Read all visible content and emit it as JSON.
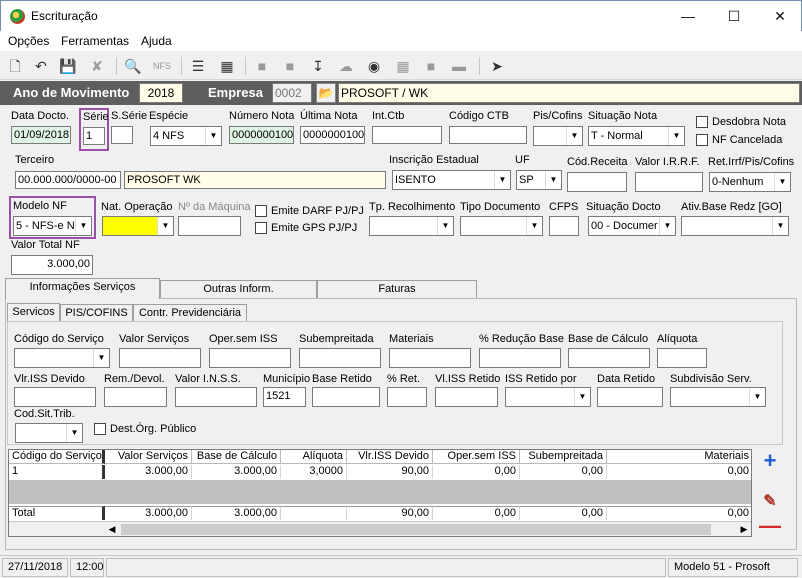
{
  "window": {
    "title": "Escrituração"
  },
  "menu": [
    "Opções",
    "Ferramentas",
    "Ajuda"
  ],
  "header": {
    "ano_label": "Ano de Movimento",
    "ano_value": "2018",
    "empresa_label": "Empresa",
    "empresa_code": "0002",
    "empresa_name": "PROSOFT / WK"
  },
  "row1": {
    "data_docto_label": "Data Docto.",
    "data_docto": "01/09/2018",
    "serie_label": "Série",
    "serie": "1",
    "sserie_label": "S.Série",
    "sserie": "",
    "especie_label": "Espécie",
    "especie": "4 NFS",
    "numero_nota_label": "Número Nota",
    "numero_nota": "0000000100",
    "ultima_nota_label": "Última Nota",
    "ultima_nota": "0000000100",
    "int_ctb_label": "Int.Ctb",
    "int_ctb": "",
    "codigo_ctb_label": "Código CTB",
    "codigo_ctb": "",
    "pis_cofins_label": "Pis/Cofins",
    "pis_cofins": "",
    "situacao_nota_label": "Situação Nota",
    "situacao_nota": "T - Normal",
    "desdobra_label": "Desdobra Nota",
    "nf_cancelada_label": "NF Cancelada"
  },
  "row2": {
    "terceiro_label": "Terceiro",
    "terceiro_code": "00.000.000/0000-00",
    "terceiro_name": "PROSOFT WK",
    "insc_est_label": "Inscrição Estadual",
    "insc_est": "ISENTO",
    "uf_label": "UF",
    "uf": "SP",
    "cod_receita_label": "Cód.Receita",
    "cod_receita": "",
    "valor_irrf_label": "Valor I.R.R.F.",
    "valor_irrf": "",
    "ret_irrf_label": "Ret.Irrf/Pis/Cofins",
    "ret_irrf": "0-Nenhum"
  },
  "row3": {
    "modelo_nf_label": "Modelo NF",
    "modelo_nf": "5 - NFS-e NF",
    "nat_operacao_label": "Nat. Operação",
    "nat_operacao": "",
    "num_maquina_label": "Nº da Máquina",
    "num_maquina": "",
    "emite_darf_label": "Emite DARF PJ/PJ",
    "emite_gps_label": "Emite GPS PJ/PJ",
    "tp_recolhimento_label": "Tp. Recolhimento",
    "tp_recolhimento": "",
    "tipo_documento_label": "Tipo Documento",
    "tipo_documento": "",
    "cfps_label": "CFPS",
    "cfps": "",
    "situacao_docto_label": "Situação Docto",
    "situacao_docto": "00 - Documer",
    "ativ_base_label": "Ativ.Base Redz [GO]",
    "ativ_base": ""
  },
  "valor_total": {
    "label": "Valor Total NF",
    "value": "3.000,00"
  },
  "main_tabs": [
    "Informações Serviços",
    "Outras Inform.",
    "Faturas"
  ],
  "sub_tabs": [
    "Servicos",
    "PIS/COFINS",
    "Contr. Previdenciária"
  ],
  "servicos": {
    "codigo_servico_label": "Código do Serviço",
    "valor_servicos_label": "Valor Serviços",
    "oper_sem_iss_label": "Oper.sem ISS",
    "subempreitada_label": "Subempreitada",
    "materiais_label": "Materiais",
    "reducao_base_label": "% Redução Base",
    "base_calculo_label": "Base de Cálculo",
    "aliquota_label": "Alíquota",
    "vlr_iss_devido_label": "Vlr.ISS Devido",
    "rem_devol_label": "Rem./Devol.",
    "valor_inss_label": "Valor I.N.S.S.",
    "municipio_label": "Município",
    "municipio": "1521",
    "base_retido_label": "Base Retido",
    "pct_ret_label": "% Ret.",
    "vl_iss_retido_label": "Vl.ISS Retido",
    "iss_retido_por_label": "ISS Retido por",
    "data_retido_label": "Data Retido",
    "subdivisao_label": "Subdivisão Serv.",
    "cod_sit_trib_label": "Cod.Sit.Trib.",
    "dest_org_publico_label": "Dest.Órg. Público"
  },
  "grid": {
    "columns": [
      "Código do Serviço",
      "Valor Serviços",
      "Base de Cálculo",
      "Alíquota",
      "Vlr.ISS Devido",
      "Oper.sem ISS",
      "Subempreitada",
      "Materiais"
    ],
    "rows": [
      [
        "1",
        "3.000,00",
        "3.000,00",
        "3,0000",
        "90,00",
        "0,00",
        "0,00",
        "0,00"
      ]
    ],
    "total": [
      "Total",
      "3.000,00",
      "3.000,00",
      "",
      "90,00",
      "0,00",
      "0,00",
      "0,00"
    ]
  },
  "status": {
    "date": "27/11/2018",
    "time": "12:00",
    "model": "Modelo 51 - Prosoft"
  }
}
